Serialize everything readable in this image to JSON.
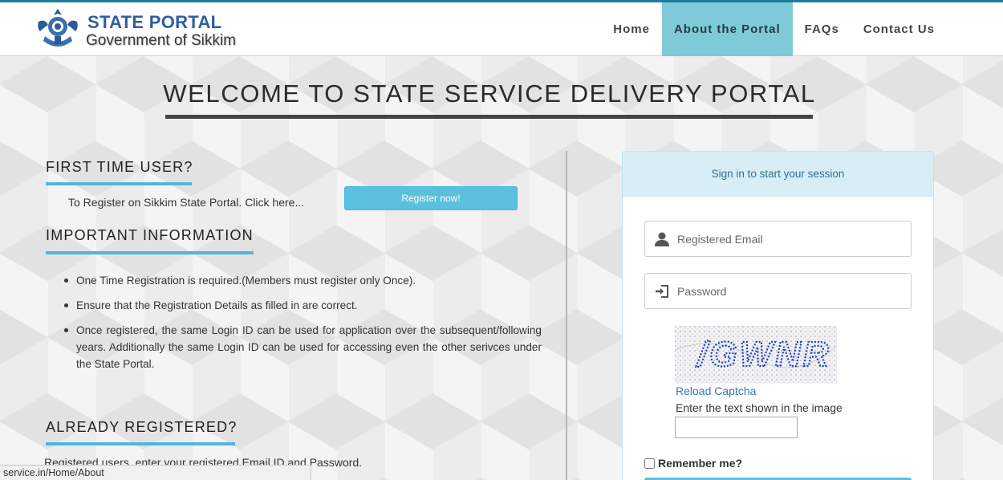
{
  "header": {
    "brand_title": "STATE PORTAL",
    "brand_subtitle": "Government of Sikkim",
    "nav": [
      {
        "label": "Home",
        "active": false
      },
      {
        "label": "About the Portal",
        "active": true
      },
      {
        "label": "FAQs",
        "active": false
      },
      {
        "label": "Contact Us",
        "active": false
      }
    ]
  },
  "headline": "WELCOME TO STATE SERVICE DELIVERY PORTAL",
  "first_time": {
    "title": "FIRST TIME USER?",
    "text": "To Register on Sikkim State Portal. Click here...",
    "button": "Register now!"
  },
  "important": {
    "title": "IMPORTANT INFORMATION",
    "items": [
      "One Time Registration is required.(Members must register only Once).",
      "Ensure that the Registration Details as filled in are correct.",
      "Once registered, the same Login ID can be used for application over the subsequent/following years. Additionally the same Login ID can be used for accessing even the other serivces under the State Portal."
    ]
  },
  "already": {
    "title": "ALREADY REGISTERED?",
    "text": "Registered users, enter your registered Email ID and Password."
  },
  "login": {
    "heading": "Sign in to start your session",
    "email_placeholder": "Registered Email",
    "password_placeholder": "Password",
    "captcha_text": "/GWNR",
    "reload_label": "Reload Captcha",
    "captcha_label": "Enter the text shown in the image",
    "remember_label": "Remember me?"
  },
  "status_bar": {
    "url": "service.in/Home/About"
  },
  "colors": {
    "accent": "#5bc0de",
    "nav_active": "#7ecad9",
    "brand": "#2f5f9e",
    "link": "#337ab7"
  }
}
